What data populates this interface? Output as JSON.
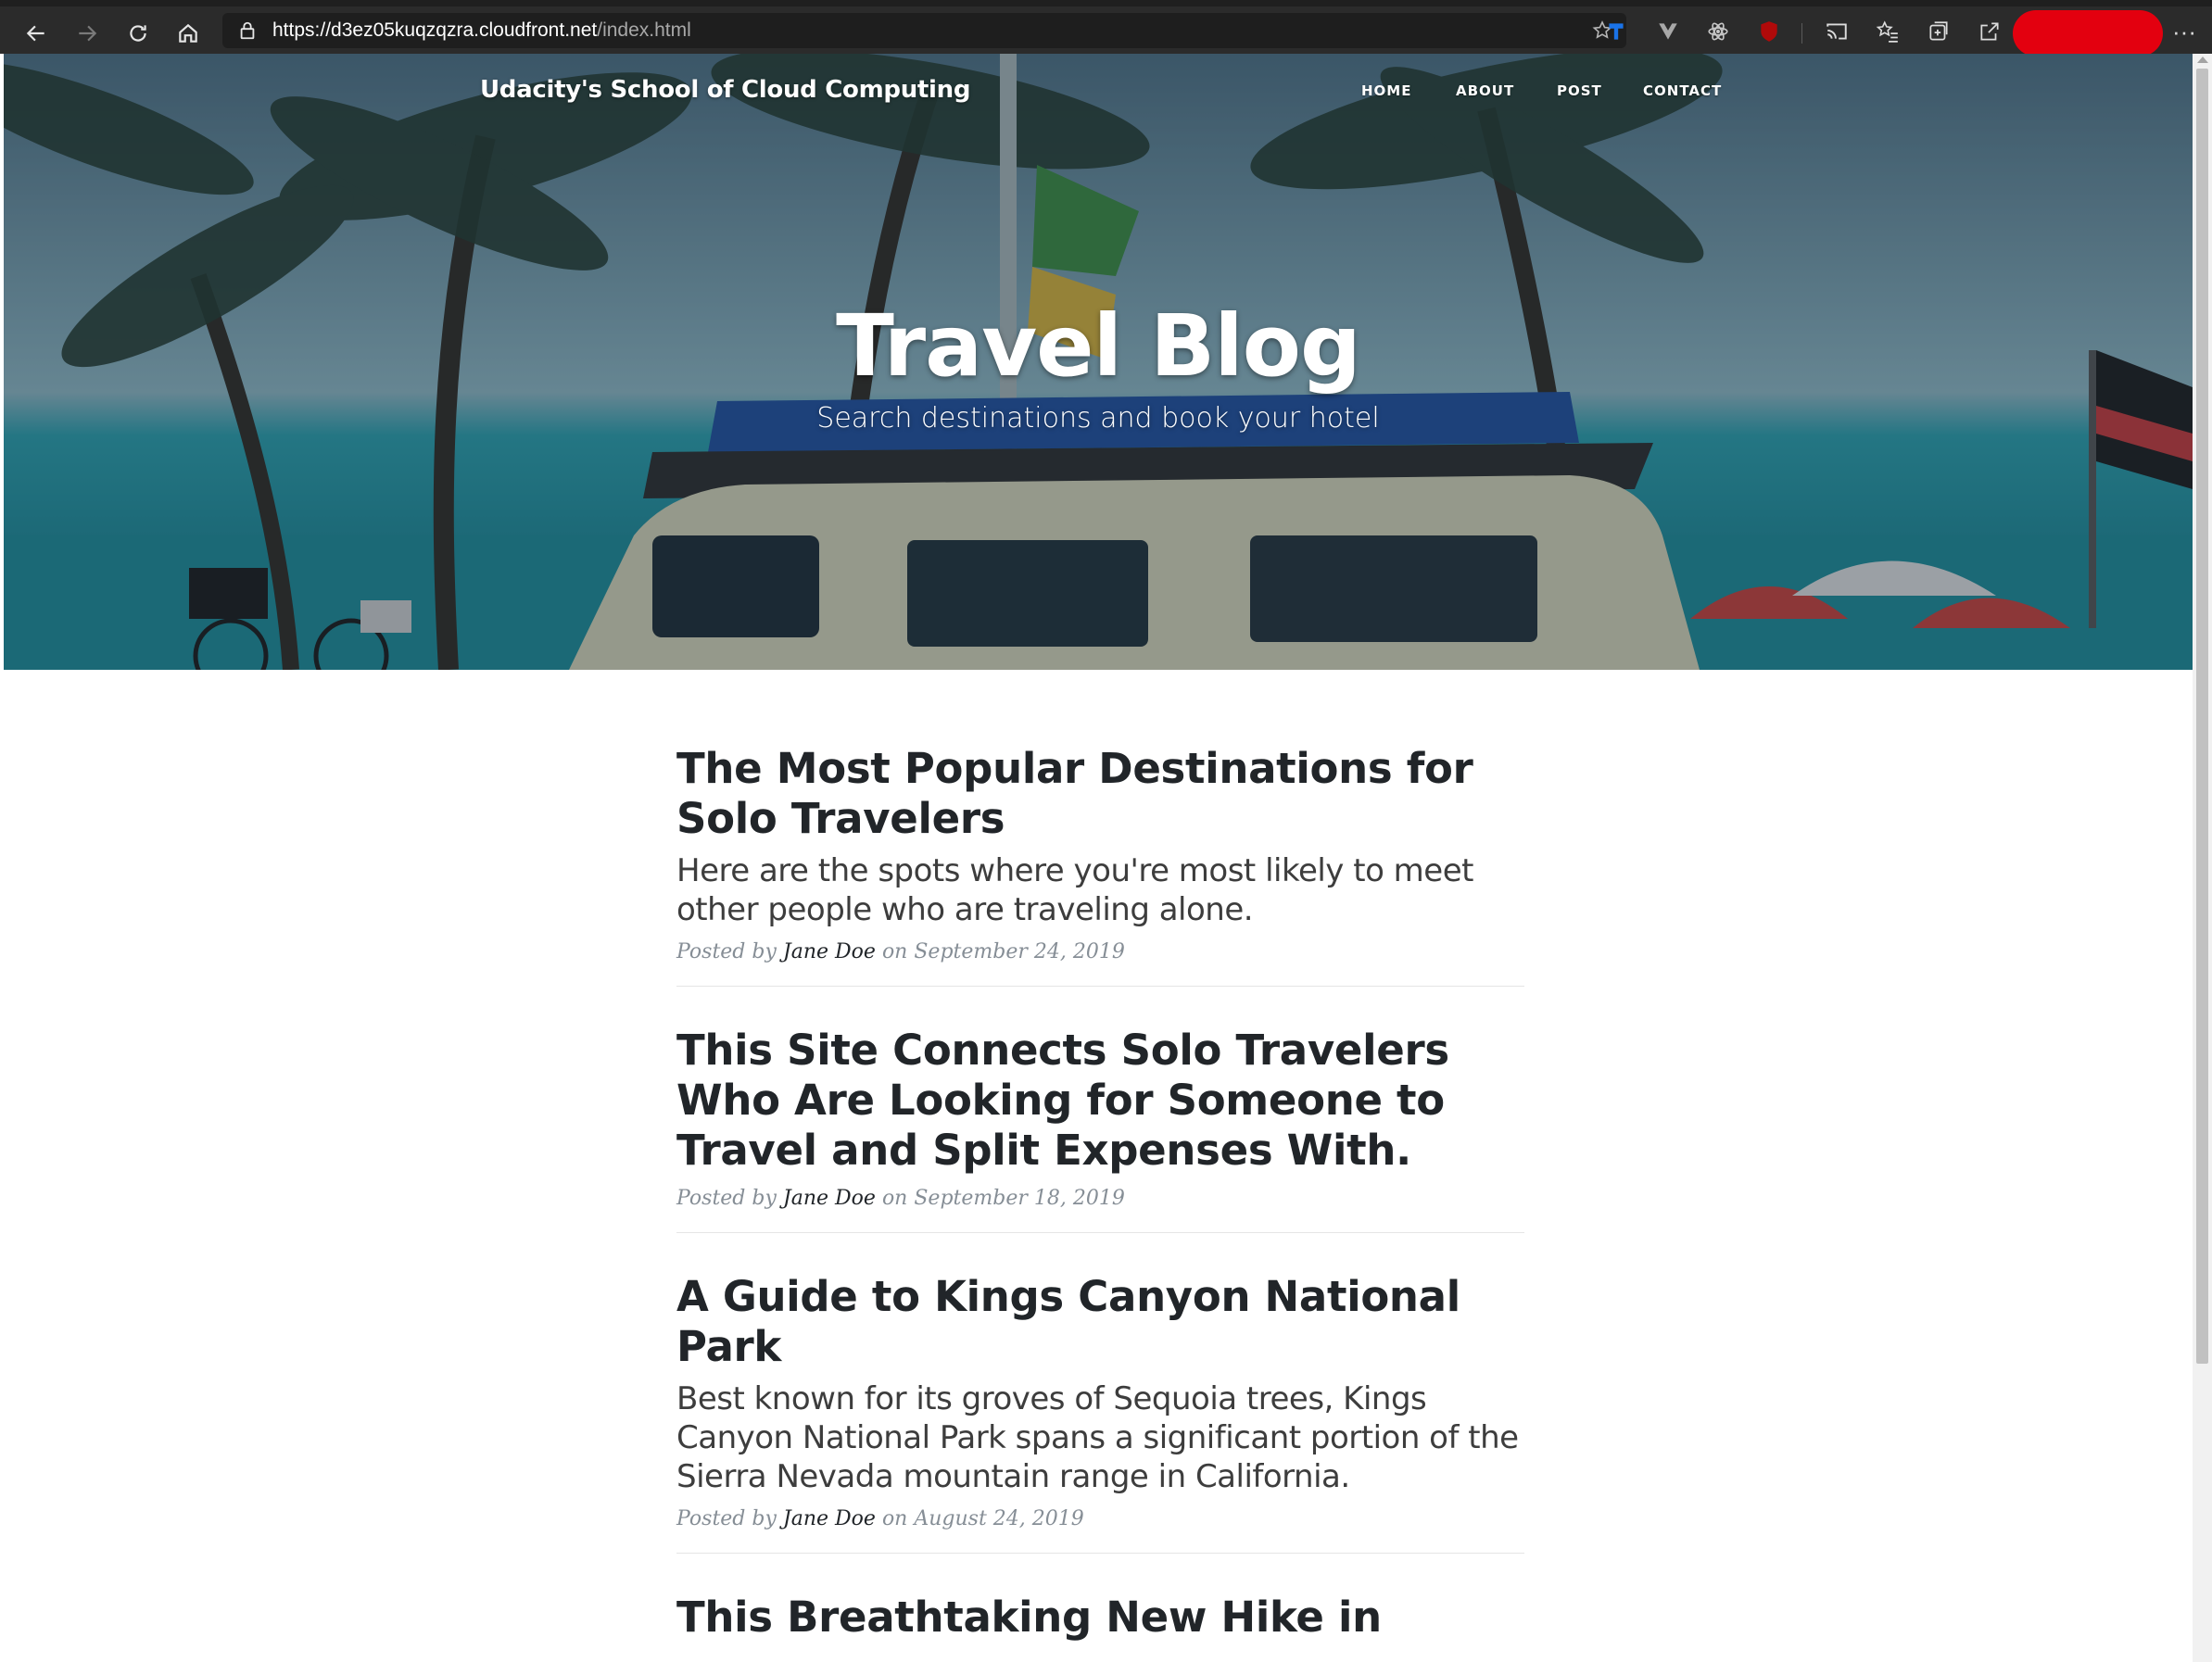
{
  "browser": {
    "url_host": "https://d3ez05kuqzqzra.cloudfront.net",
    "url_path": "/index.html"
  },
  "site": {
    "brand": "Udacity's School of Cloud Computing",
    "nav": [
      {
        "label": "HOME"
      },
      {
        "label": "ABOUT"
      },
      {
        "label": "POST"
      },
      {
        "label": "CONTACT"
      }
    ],
    "hero_title": "Travel Blog",
    "hero_subtitle": "Search destinations and book your hotel"
  },
  "posts": [
    {
      "title": "The Most Popular Destinations for Solo Travelers",
      "subtitle": "Here are the spots where you're most likely to meet other people who are traveling alone.",
      "posted_by": "Posted by",
      "author": "Jane Doe",
      "on": "on",
      "date": "September 24, 2019"
    },
    {
      "title": "This Site Connects Solo Travelers Who Are Looking for Someone to Travel and Split Expenses With.",
      "subtitle": "",
      "posted_by": "Posted by",
      "author": "Jane Doe",
      "on": "on",
      "date": "September 18, 2019"
    },
    {
      "title": "A Guide to Kings Canyon National Park",
      "subtitle": "Best known for its groves of Sequoia trees, Kings Canyon National Park spans a significant portion of the Sierra Nevada mountain range in California.",
      "posted_by": "Posted by",
      "author": "Jane Doe",
      "on": "on",
      "date": "August 24, 2019"
    },
    {
      "title": "This Breathtaking New Hike in",
      "subtitle": "",
      "posted_by": "",
      "author": "",
      "on": "",
      "date": ""
    }
  ]
}
